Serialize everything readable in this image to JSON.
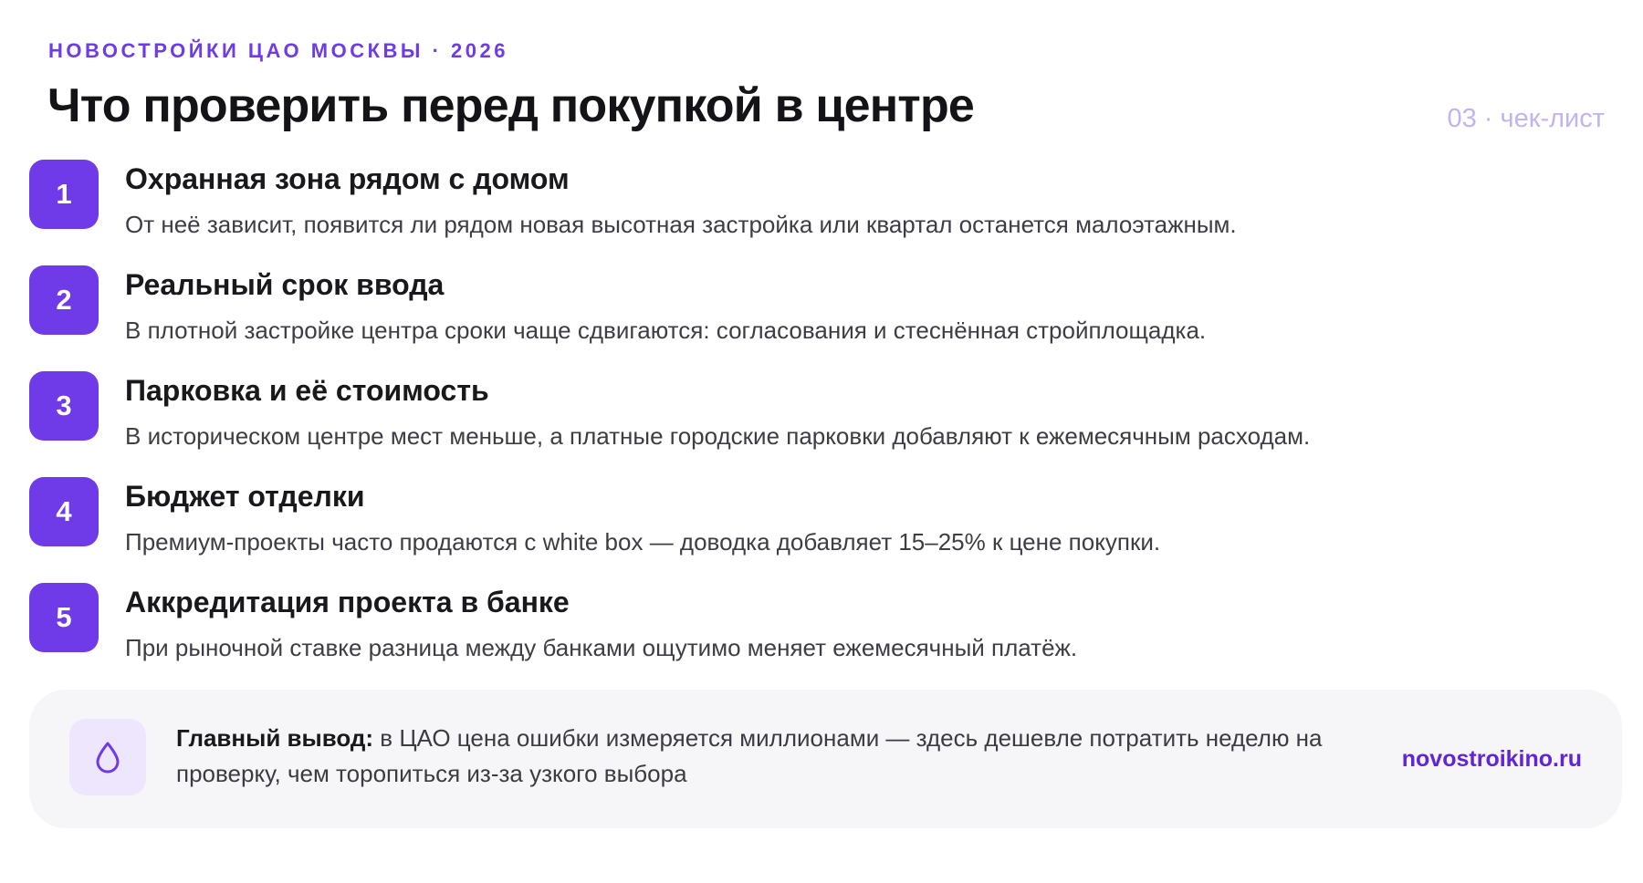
{
  "header": {
    "eyebrow": "НОВОСТРОЙКИ ЦАО МОСКВЫ · 2026",
    "title": "Что проверить перед покупкой в центре",
    "slide_tag": "03 · чек-лист"
  },
  "checklist": [
    {
      "number": "1",
      "title": "Охранная зона рядом с домом",
      "description": "От неё зависит, появится ли рядом новая высотная застройка или квартал останется малоэтажным."
    },
    {
      "number": "2",
      "title": "Реальный срок ввода",
      "description": "В плотной застройке центра сроки чаще сдвигаются: согласования и стеснённая стройплощадка."
    },
    {
      "number": "3",
      "title": "Парковка и её стоимость",
      "description": "В историческом центре мест меньше, а платные городские парковки добавляют к ежемесячным расходам."
    },
    {
      "number": "4",
      "title": "Бюджет отделки",
      "description": "Премиум-проекты часто продаются с white box — доводка добавляет 15–25% к цене покупки."
    },
    {
      "number": "5",
      "title": "Аккредитация проекта в банке",
      "description": "При рыночной ставке разница между банками ощутимо меняет ежемесячный платёж."
    }
  ],
  "summary": {
    "icon": "drop-icon",
    "label": "Главный вывод:",
    "text": " в ЦАО цена ошибки измеряется миллионами — здесь дешевле потратить неделю на проверку, чем торопиться из-за узкого выбора",
    "site": "novostroikino.ru"
  },
  "colors": {
    "accent": "#6f3ae8",
    "eyebrow": "#6d3ce6",
    "slide_tag": "#c3b3ee",
    "summary_bg": "#f6f6f9",
    "icon_bg": "#ede6fc"
  }
}
